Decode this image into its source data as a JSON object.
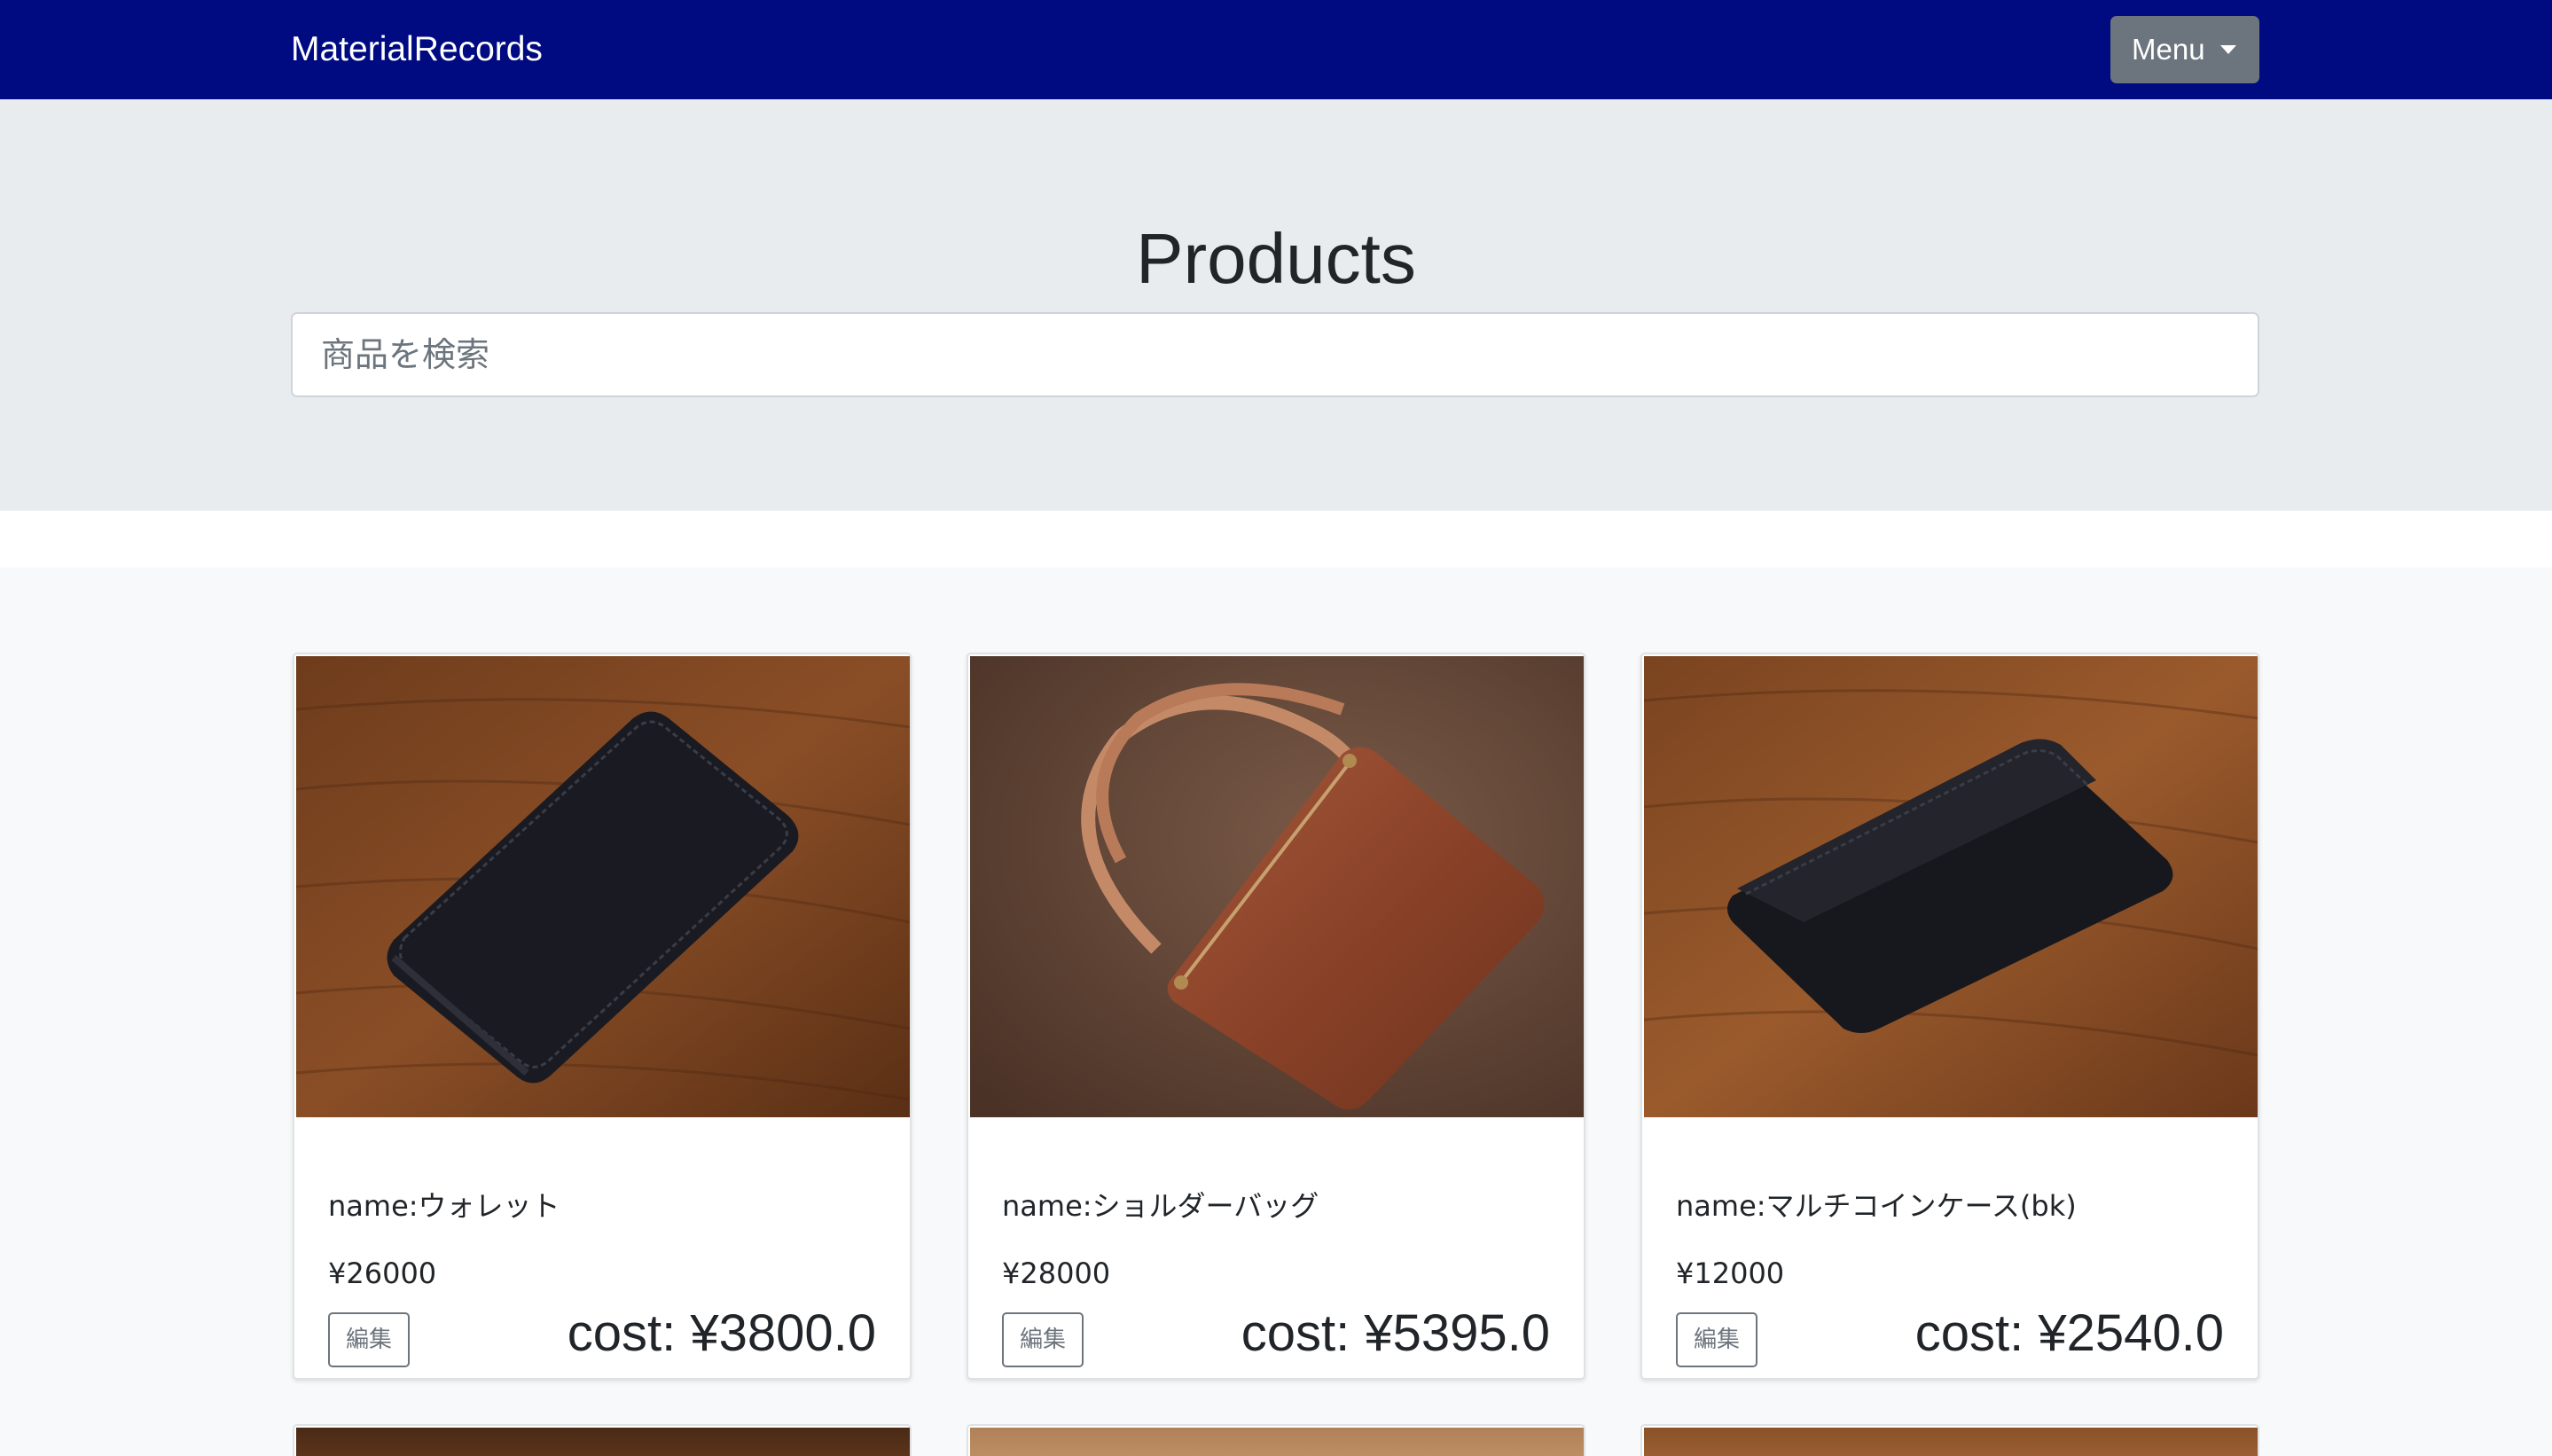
{
  "navbar": {
    "brand": "MaterialRecords",
    "menu_label": "Menu"
  },
  "header": {
    "title": "Products",
    "search_placeholder": "商品を検索"
  },
  "products": [
    {
      "name": "name:ウォレット",
      "price": "¥26000",
      "edit_label": "編集",
      "cost": "cost: ¥3800.0",
      "image": "black-wallet-photo"
    },
    {
      "name": "name:ショルダーバッグ",
      "price": "¥28000",
      "edit_label": "編集",
      "cost": "cost: ¥5395.0",
      "image": "brown-shoulder-bag-photo"
    },
    {
      "name": "name:マルチコインケース(bk)",
      "price": "¥12000",
      "edit_label": "編集",
      "cost": "cost: ¥2540.0",
      "image": "black-coin-case-photo"
    }
  ],
  "colors": {
    "navbar": "#000b82",
    "menu_button": "#6c757d",
    "hero_background": "#e9ecef",
    "album_background": "#f8f9fa"
  }
}
